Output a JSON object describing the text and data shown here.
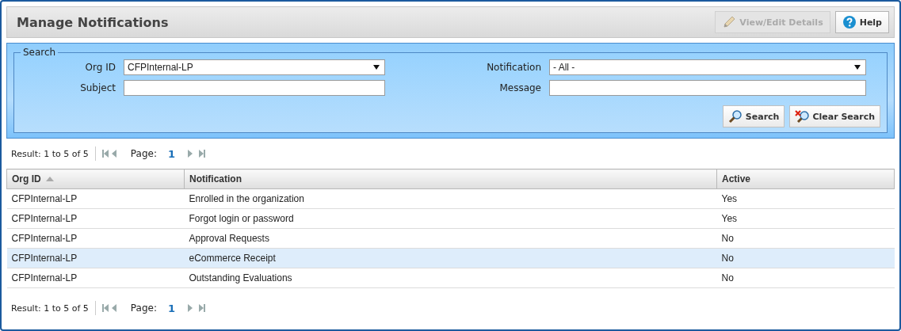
{
  "title": "Manage Notifications",
  "toolbar": [
    {
      "label": "View/Edit Details",
      "kind": "edit",
      "disabled": true
    },
    {
      "label": "Help",
      "kind": "help",
      "disabled": false
    }
  ],
  "search": {
    "legend": "Search",
    "fields": [
      {
        "label": "Org ID",
        "kind": "select",
        "value": "CFPInternal-LP"
      },
      {
        "label": "Notification",
        "kind": "select",
        "value": "- All -"
      },
      {
        "label": "Subject",
        "kind": "text"
      },
      {
        "label": "Message",
        "kind": "text"
      }
    ],
    "buttons": [
      {
        "label": "Search",
        "kind": "search"
      },
      {
        "label": "Clear Search",
        "kind": "clear"
      }
    ]
  },
  "pager_top": {
    "result": "Result: 1 to 5 of 5",
    "page_label": "Page:",
    "page": "1"
  },
  "table": {
    "columns": [
      {
        "label": "Org ID",
        "sorted": true
      },
      {
        "label": "Notification",
        "sorted": false
      },
      {
        "label": "Active",
        "sorted": false
      }
    ],
    "rows": [
      {
        "cells": [
          "CFPInternal-LP",
          "Enrolled in the organization",
          "Yes"
        ],
        "selected": false
      },
      {
        "cells": [
          "CFPInternal-LP",
          "Forgot login or password",
          "Yes"
        ],
        "selected": false
      },
      {
        "cells": [
          "CFPInternal-LP",
          "Approval Requests",
          "No"
        ],
        "selected": false
      },
      {
        "cells": [
          "CFPInternal-LP",
          "eCommerce Receipt",
          "No"
        ],
        "selected": true
      },
      {
        "cells": [
          "CFPInternal-LP",
          "Outstanding Evaluations",
          "No"
        ],
        "selected": false
      }
    ]
  },
  "pager_bottom": {
    "result": "Result: 1 to 5 of 5",
    "page_label": "Page:",
    "page": "1"
  }
}
